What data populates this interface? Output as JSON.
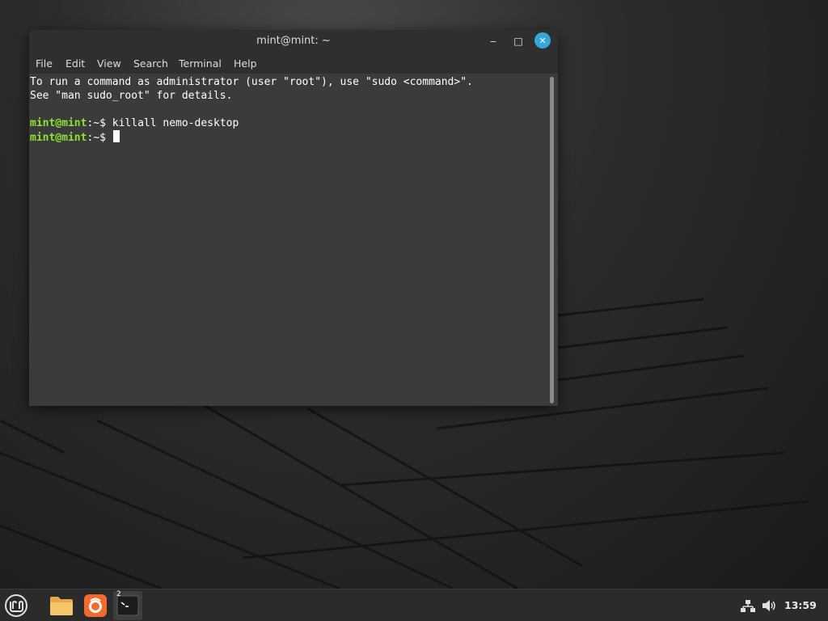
{
  "window": {
    "title": "mint@mint: ~",
    "minimize_glyph": "‒",
    "maximize_glyph": "□",
    "close_glyph": "✕"
  },
  "menu": {
    "items": [
      "File",
      "Edit",
      "View",
      "Search",
      "Terminal",
      "Help"
    ]
  },
  "terminal": {
    "line1": "To run a command as administrator (user \"root\"), use \"sudo <command>\".",
    "line2": "See \"man sudo_root\" for details.",
    "prompt_user": "mint@mint",
    "prompt_path": ":~$ ",
    "command1": "killall nemo-desktop",
    "command2": ""
  },
  "taskbar": {
    "workspace_number": "2",
    "clock": "13:59",
    "icons": [
      "mint-menu-icon",
      "files-icon",
      "firefox-icon",
      "terminal-icon",
      "network-icon",
      "volume-icon"
    ]
  },
  "colors": {
    "prompt_green": "#8ae234",
    "close_button_blue": "#35a7d6",
    "terminal_bg": "#3b3b3b",
    "taskbar_bg": "#2b2b2b"
  }
}
